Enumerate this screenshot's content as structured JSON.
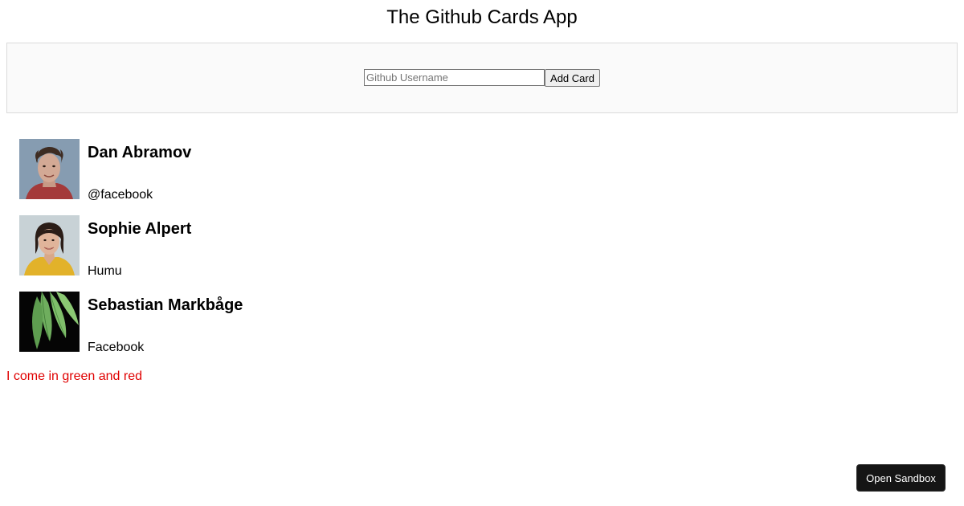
{
  "app": {
    "title": "The Github Cards App"
  },
  "form": {
    "username_placeholder": "Github Username",
    "username_value": "",
    "add_card_label": "Add Card"
  },
  "cards": [
    {
      "name": "Dan Abramov",
      "company": "@facebook",
      "avatar_icon": "avatar-photo-dan-abramov"
    },
    {
      "name": "Sophie Alpert",
      "company": "Humu",
      "avatar_icon": "avatar-photo-sophie-alpert"
    },
    {
      "name": "Sebastian Markbåge",
      "company": "Facebook",
      "avatar_icon": "avatar-leaves-sebastian-markbage"
    }
  ],
  "footer": {
    "note": "I come in green and red",
    "note_color": "#e00000"
  },
  "sandbox": {
    "label": "Open Sandbox"
  },
  "colors": {
    "panel_bg": "#fafafa",
    "sandbox_bg": "#151515"
  }
}
